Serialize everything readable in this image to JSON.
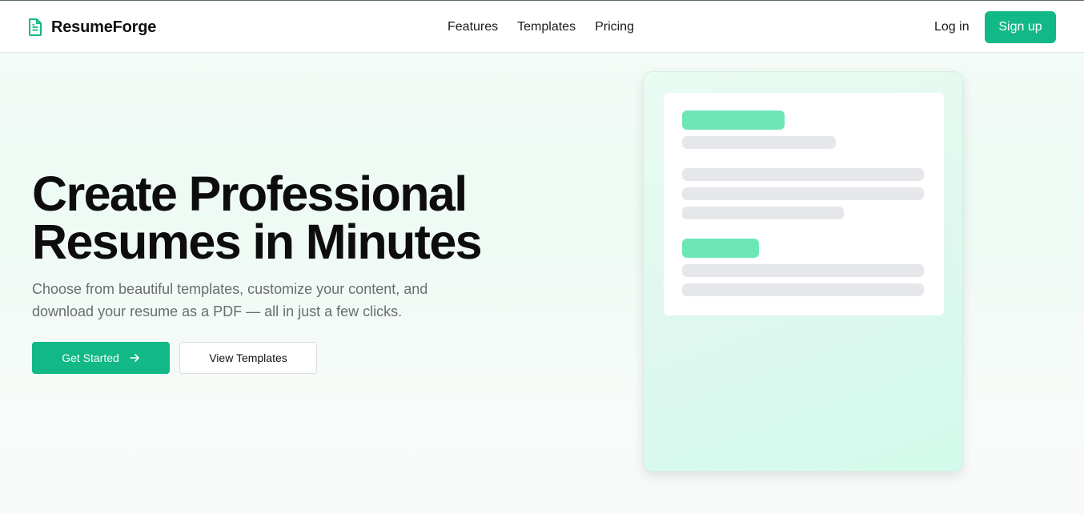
{
  "header": {
    "brand": "ResumeForge",
    "nav": [
      "Features",
      "Templates",
      "Pricing"
    ],
    "login": "Log in",
    "signup": "Sign up"
  },
  "hero": {
    "title_line1": "Create Professional",
    "title_line2": "Resumes in Minutes",
    "subtitle_line1": "Choose from beautiful templates, customize your content, and",
    "subtitle_line2": "download your resume as a PDF — all in just a few clicks.",
    "primary_cta": "Get Started",
    "secondary_cta": "View Templates"
  },
  "icons": {
    "brand": "document-icon",
    "cta": "arrow-right-icon"
  },
  "colors": {
    "accent": "#12b886",
    "accent_light": "#6ee7b7",
    "placeholder": "#e6e7ea"
  }
}
